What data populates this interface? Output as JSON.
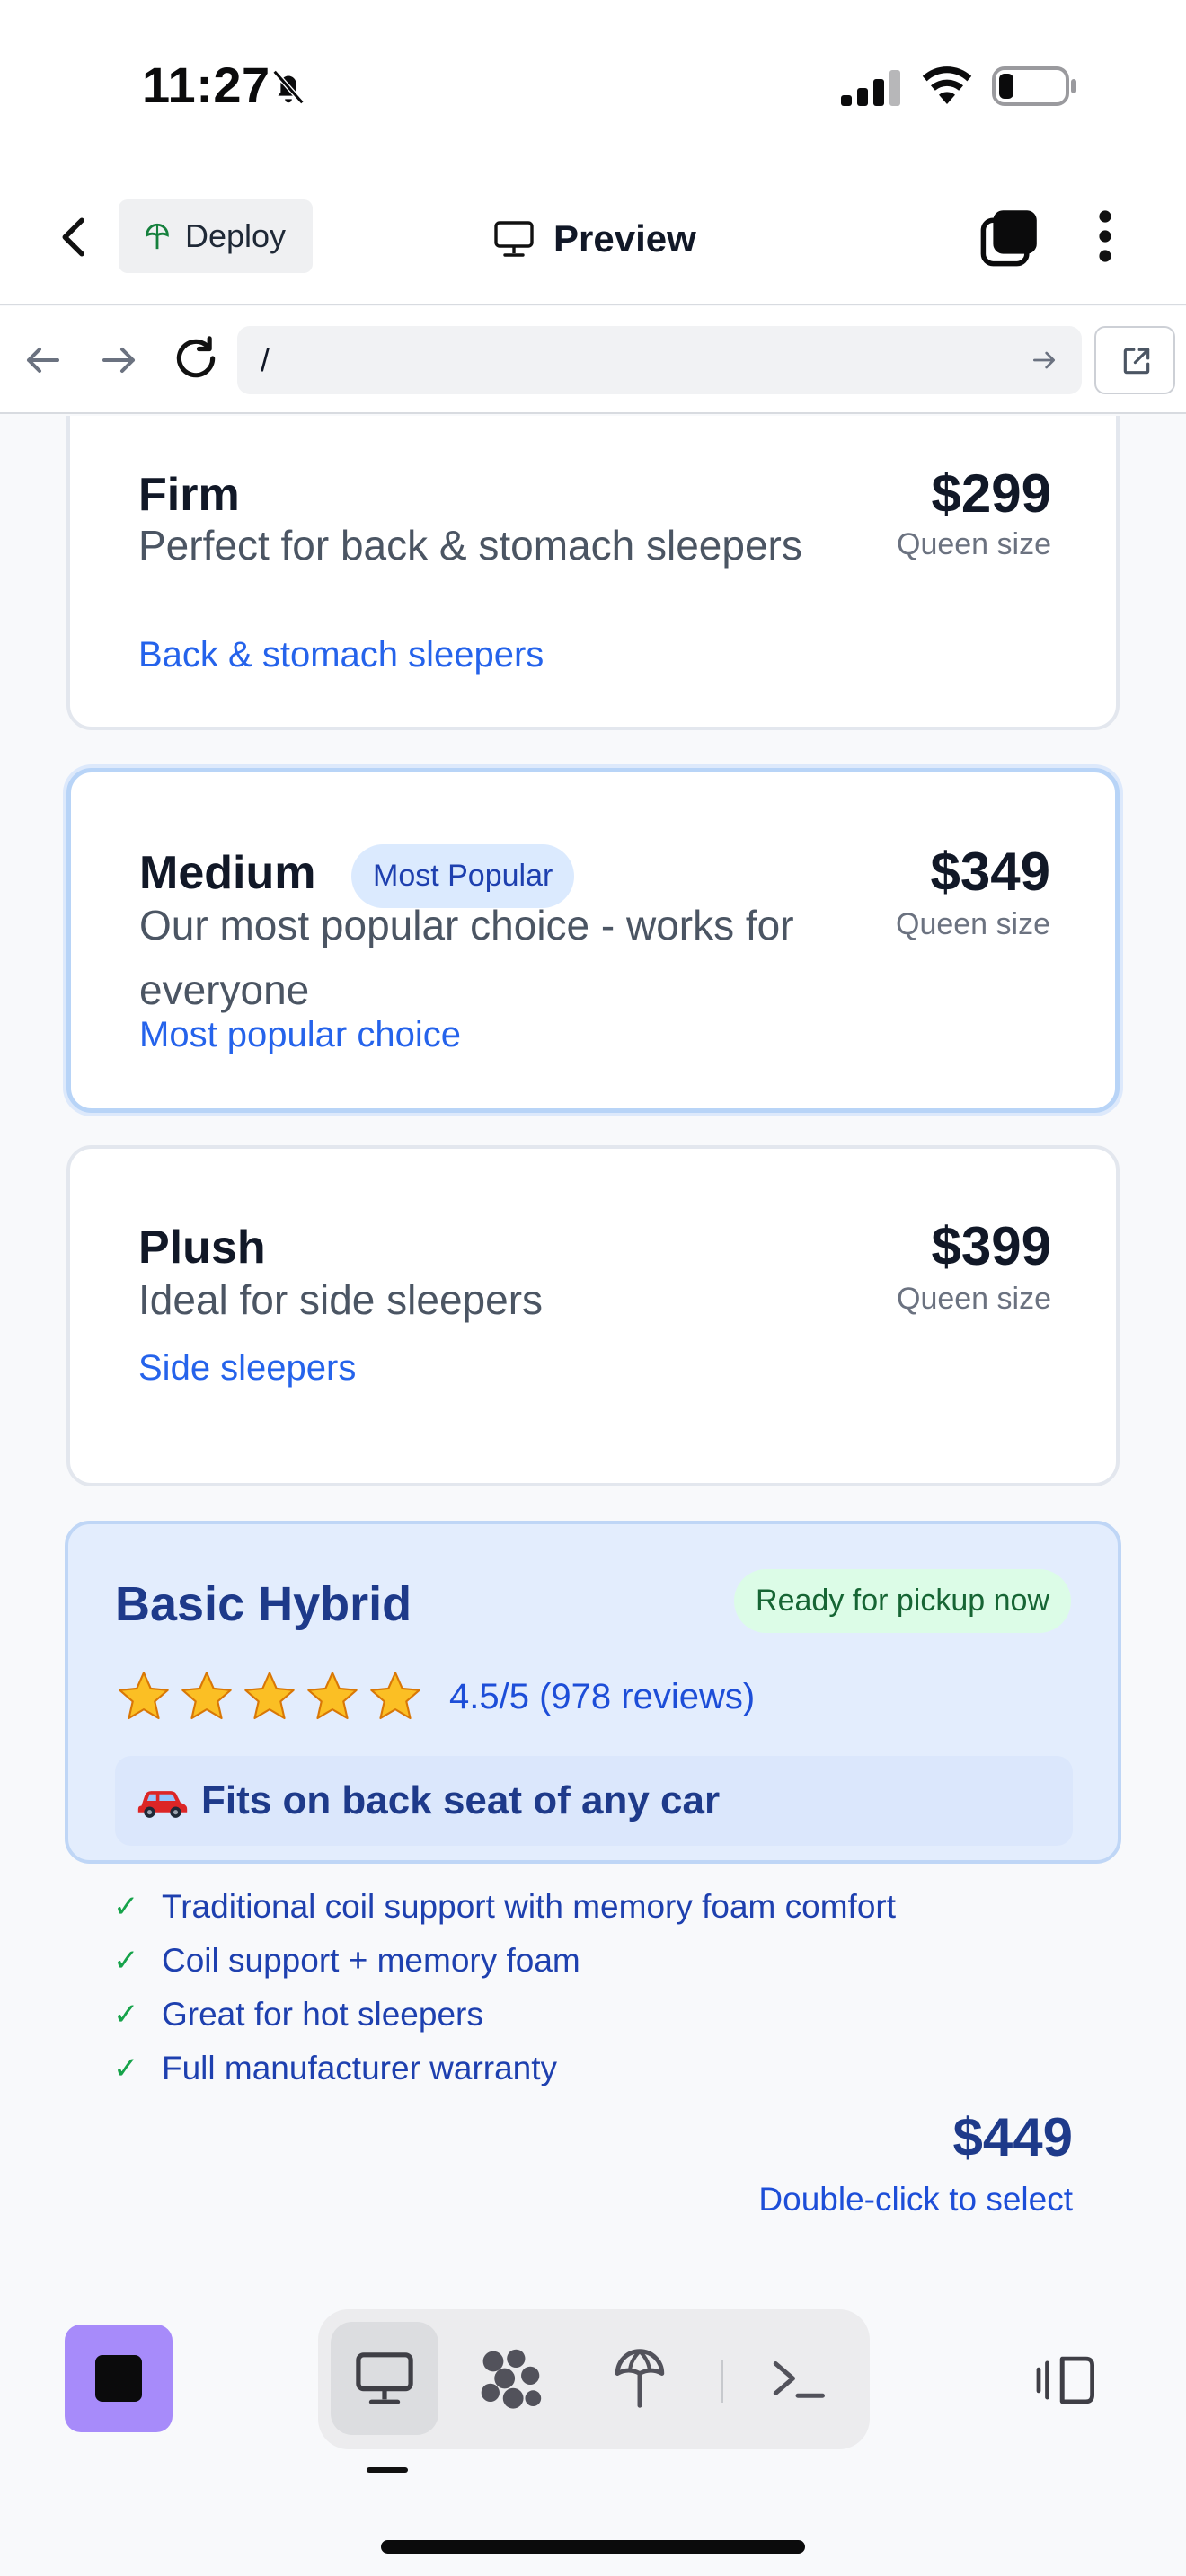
{
  "status_bar": {
    "time": "11:27"
  },
  "header": {
    "deploy_label": "Deploy",
    "preview_label": "Preview"
  },
  "url_bar": {
    "path": "/"
  },
  "options": [
    {
      "name": "Firm",
      "price": "$299",
      "size": "Queen size",
      "desc": "Perfect for back & stomach sleepers",
      "tag": "Back & stomach sleepers"
    },
    {
      "name": "Medium",
      "badge": "Most Popular",
      "price": "$349",
      "size": "Queen size",
      "desc": "Our most popular choice - works for everyone",
      "tag": "Most popular choice"
    },
    {
      "name": "Plush",
      "price": "$399",
      "size": "Queen size",
      "desc": "Ideal for side sleepers",
      "tag": "Side sleepers"
    }
  ],
  "hybrid": {
    "name": "Basic Hybrid",
    "badge": "Ready for pickup now",
    "stars": 5,
    "rating": "4.5/5 (978 reviews)",
    "fits": "Fits on back seat of any car",
    "features": [
      "Traditional coil support with memory foam comfort",
      "Coil support + memory foam",
      "Great for hot sleepers",
      "Full manufacturer warranty"
    ],
    "price": "$449",
    "hint": "Double-click to select"
  },
  "colors": {
    "accent": "#2563eb",
    "selected_border": "#b8d4f7",
    "hybrid_bg": "#e3edfd",
    "stop_button": "#a78bfa"
  },
  "icons": [
    "bell-off-icon",
    "signal-icon",
    "wifi-icon",
    "battery-icon",
    "back-icon",
    "deploy-icon",
    "monitor-icon",
    "tabs-icon",
    "more-icon",
    "arrow-left-icon",
    "arrow-right-icon",
    "reload-icon",
    "open-external-icon",
    "star-icon",
    "car-icon",
    "check-icon",
    "stop-icon",
    "desktop-icon",
    "grid-icon",
    "deploy-icon",
    "terminal-icon",
    "panel-icon"
  ]
}
